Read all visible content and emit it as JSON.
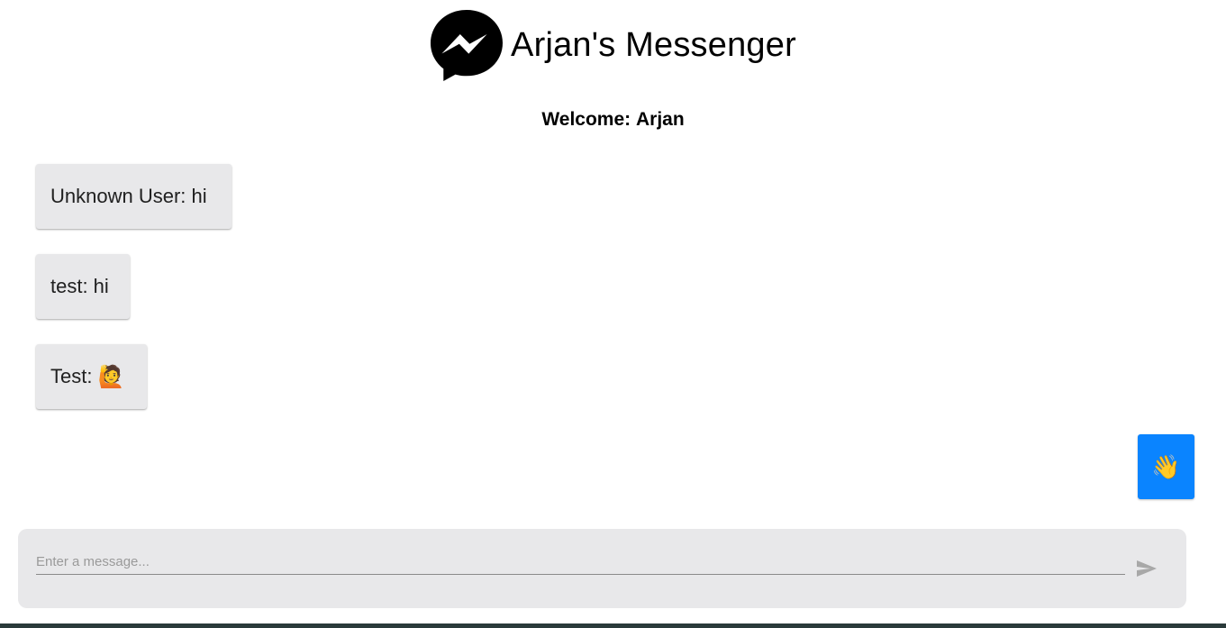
{
  "header": {
    "title": "Arjan's Messenger",
    "logo_icon": "messenger-logo-icon"
  },
  "welcome": {
    "label": "Welcome:",
    "username": "Arjan"
  },
  "messages": [
    {
      "text": "Unknown User: hi",
      "emoji": ""
    },
    {
      "text": "test: hi",
      "emoji": ""
    },
    {
      "text": "Test:",
      "emoji": "🙋"
    }
  ],
  "own_message": {
    "emoji": "👋",
    "color": "#0a84ff"
  },
  "composer": {
    "placeholder": "Enter a message...",
    "value": "",
    "send_icon": "send-icon"
  },
  "colors": {
    "bubble": "#e8e8ea",
    "accent": "#0a84ff"
  }
}
